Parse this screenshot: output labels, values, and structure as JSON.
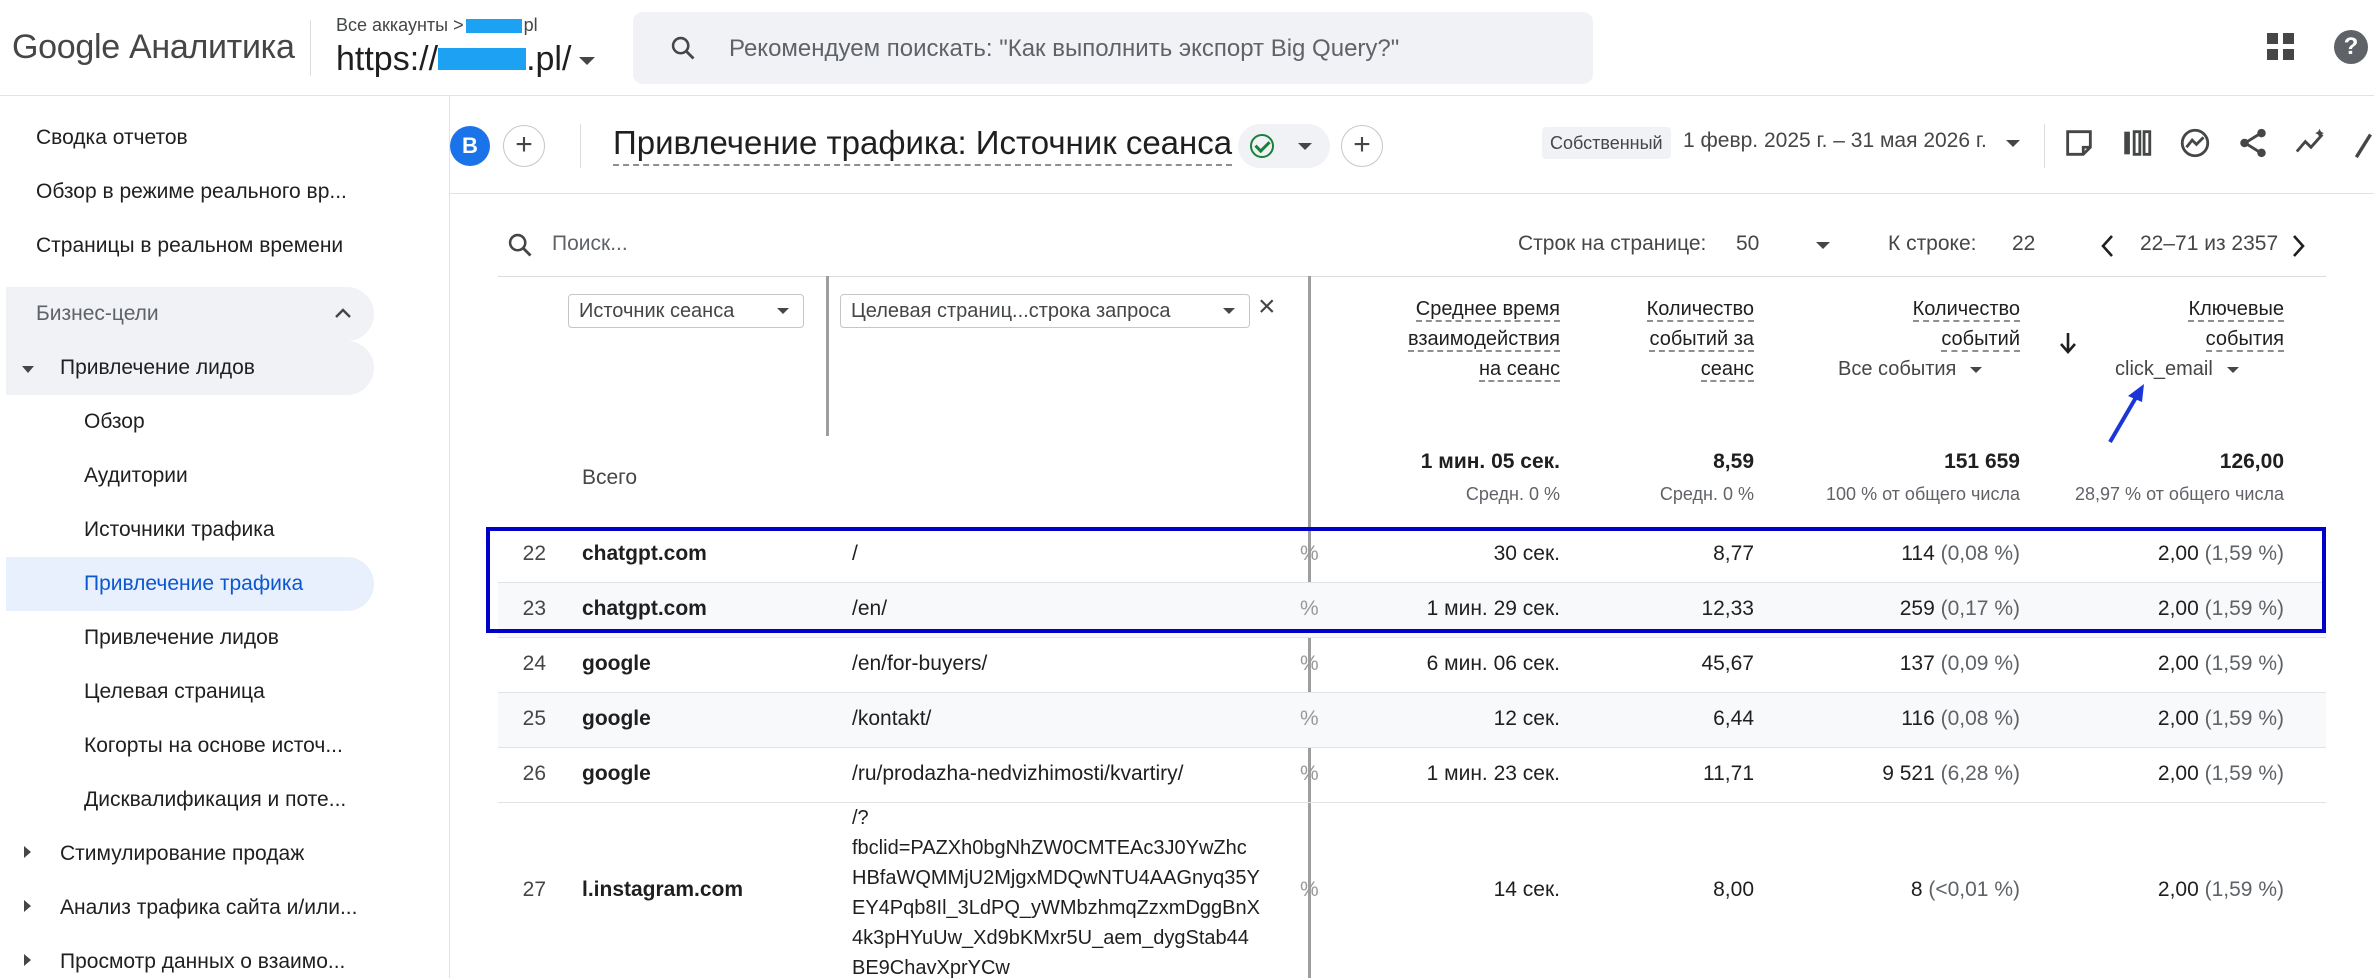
{
  "topbar": {
    "logo": "Google Аналитика",
    "account_crumb_prefix": "Все аккаунты >",
    "account_crumb_suffix": "pl",
    "property_prefix": "https://",
    "property_suffix": ".pl/",
    "search_placeholder": "Рекомендуем поискать: \"Как выполнить экспорт Big Query?\"",
    "help_label": "?"
  },
  "sidebar": {
    "items": [
      {
        "label": "Сводка отчетов"
      },
      {
        "label": "Обзор в режиме реального вр..."
      },
      {
        "label": "Страницы в реальном времени"
      }
    ],
    "section": "Бизнес-цели",
    "group": "Привлечение лидов",
    "sub_items": [
      {
        "label": "Обзор"
      },
      {
        "label": "Аудитории"
      },
      {
        "label": "Источники трафика"
      },
      {
        "label": "Привлечение трафика"
      },
      {
        "label": "Привлечение лидов"
      },
      {
        "label": "Целевая страница"
      },
      {
        "label": "Когорты на основе источ..."
      },
      {
        "label": "Дисквалификация и поте..."
      }
    ],
    "collapsed": [
      {
        "label": "Стимулирование продаж"
      },
      {
        "label": "Анализ трафика сайта и/или..."
      },
      {
        "label": "Просмотр данных о взаимо..."
      }
    ]
  },
  "report": {
    "avatar": "B",
    "add_label": "+",
    "title": "Привлечение трафика: Источник сеанса",
    "date_chip": "Собственный",
    "date_range": "1 февр. 2025 г. – 31 мая 2026 г."
  },
  "table": {
    "search_placeholder": "Поиск...",
    "rows_per_page_label": "Строк на странице:",
    "rows_per_page": "50",
    "go_to_label": "К строке:",
    "go_to": "22",
    "pager": "22–71 из 2357",
    "dim1": "Источник сеанса",
    "dim2": "Целевая страниц...строка запроса",
    "close": "×",
    "headers": {
      "avg_time": [
        "Среднее время",
        "взаимодействия",
        "на сеанс"
      ],
      "events_per_session": [
        "Количество",
        "событий за",
        "сеанс"
      ],
      "event_count": [
        "Количество",
        "событий"
      ],
      "event_count_sub": "Все события",
      "key_events": [
        "Ключевые",
        "события"
      ],
      "key_events_sub": "click_email"
    },
    "totals": {
      "label": "Всего",
      "avg_time": "1 мин. 05 сек.",
      "avg_time_sub": "Средн. 0 %",
      "eps": "8,59",
      "eps_sub": "Средн. 0 %",
      "events": "151 659",
      "events_sub": "100 % от общего числа",
      "key": "126,00",
      "key_sub": "28,97 % от общего числа"
    },
    "rows": [
      {
        "n": "22",
        "src": "chatgpt.com",
        "page": "/",
        "time": "30 сек.",
        "eps": "8,77",
        "ev": "114",
        "ev_pct": "(0,08 %)",
        "key": "2,00",
        "key_pct": "(1,59 %)"
      },
      {
        "n": "23",
        "src": "chatgpt.com",
        "page": "/en/",
        "time": "1 мин. 29 сек.",
        "eps": "12,33",
        "ev": "259",
        "ev_pct": "(0,17 %)",
        "key": "2,00",
        "key_pct": "(1,59 %)"
      },
      {
        "n": "24",
        "src": "google",
        "page": "/en/for-buyers/",
        "time": "6 мин. 06 сек.",
        "eps": "45,67",
        "ev": "137",
        "ev_pct": "(0,09 %)",
        "key": "2,00",
        "key_pct": "(1,59 %)"
      },
      {
        "n": "25",
        "src": "google",
        "page": "/kontakt/",
        "time": "12 сек.",
        "eps": "6,44",
        "ev": "116",
        "ev_pct": "(0,08 %)",
        "key": "2,00",
        "key_pct": "(1,59 %)"
      },
      {
        "n": "26",
        "src": "google",
        "page": "/ru/prodazha-nedvizhimosti/kvartiry/",
        "time": "1 мин. 23 сек.",
        "eps": "11,71",
        "ev": "9 521",
        "ev_pct": "(6,28 %)",
        "key": "2,00",
        "key_pct": "(1,59 %)"
      },
      {
        "n": "27",
        "src": "l.instagram.com",
        "page": "/?\nfbclid=PAZXh0bgNhZW0CMTEAc3J0YwZhc\nHBfaWQMMjU2MjgxMDQwNTU4AAGnyq35Y\nEY4Pqb8Il_3LdPQ_yWMbzhmqZzxmDggBnX\n4k3pHYuUw_Xd9bKMxr5U_aem_dygStab44\nBE9ChavXprYCw",
        "time": "14 сек.",
        "eps": "8,00",
        "ev": "8",
        "ev_pct": "(<0,01 %)",
        "key": "2,00",
        "key_pct": "(1,59 %)"
      }
    ]
  },
  "colors": {
    "accent": "#0b57d0",
    "highlight": "#0000c8",
    "arrow": "#1a35d8"
  }
}
